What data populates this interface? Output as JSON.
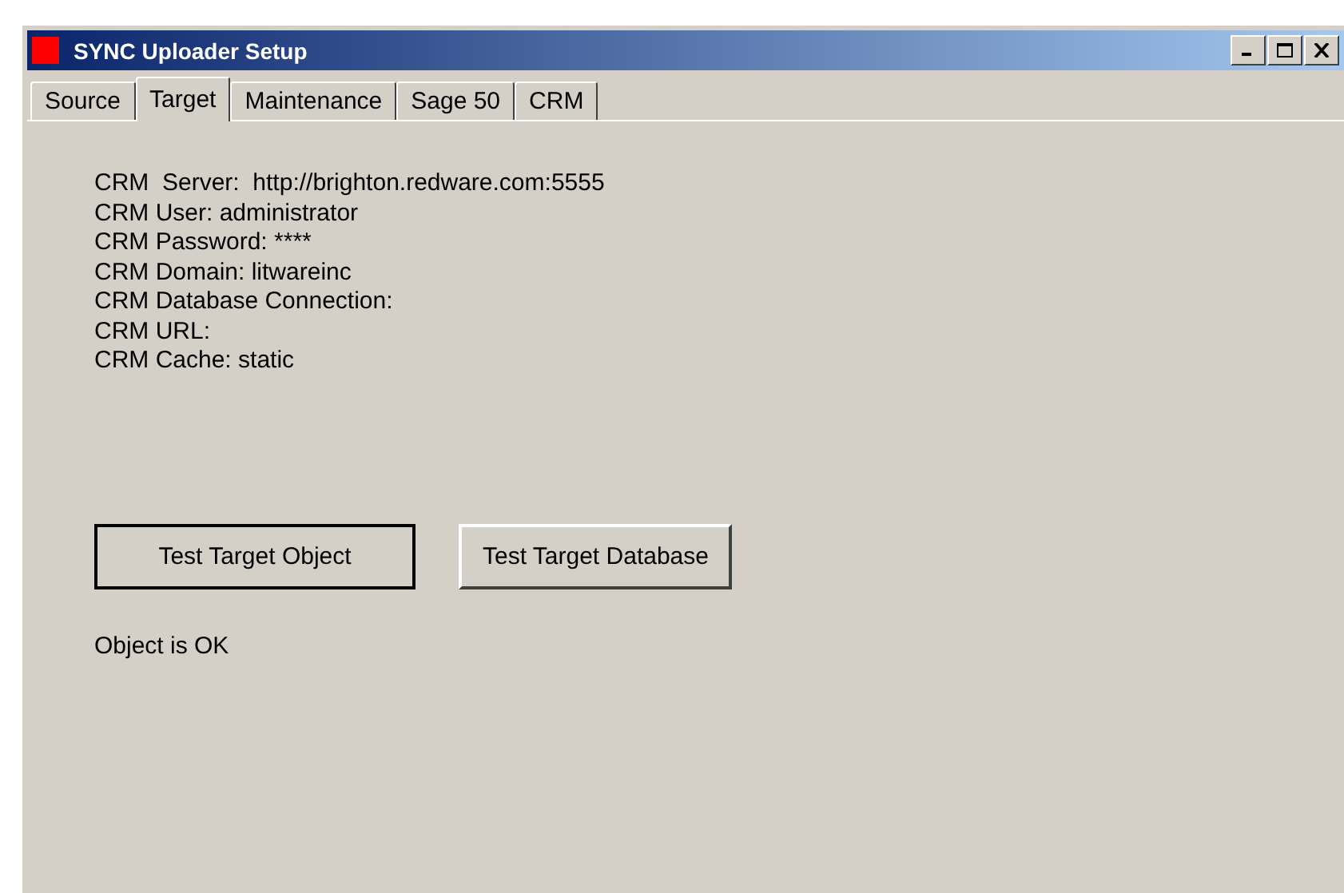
{
  "window": {
    "title": "SYNC Uploader Setup"
  },
  "tabs": [
    {
      "label": "Source",
      "selected": false
    },
    {
      "label": "Target",
      "selected": true
    },
    {
      "label": "Maintenance",
      "selected": false
    },
    {
      "label": "Sage 50",
      "selected": false
    },
    {
      "label": "CRM",
      "selected": false
    }
  ],
  "info_lines": [
    "CRM  Server:  http://brighton.redware.com:5555",
    "CRM User: administrator",
    "CRM Password: ****",
    "CRM Domain: litwareinc",
    "CRM Database Connection:",
    "CRM URL:",
    "CRM Cache: static"
  ],
  "buttons": [
    {
      "label": "Test Target Object",
      "focused": true
    },
    {
      "label": "Test Target Database",
      "focused": false
    }
  ],
  "status": "Object is OK"
}
